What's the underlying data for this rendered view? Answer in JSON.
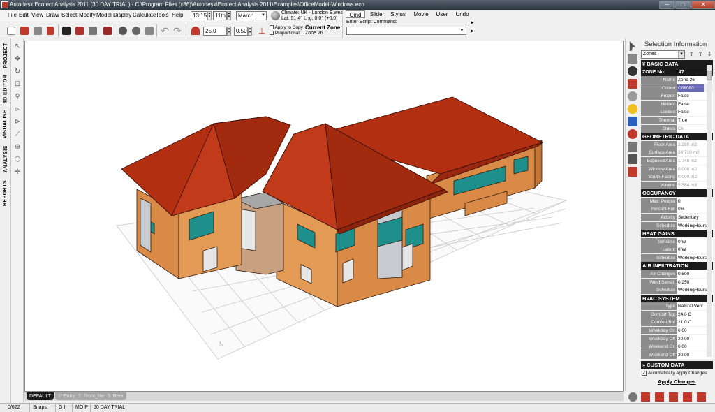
{
  "window": {
    "title": "Autodesk Ecotect Analysis 2011 (30 DAY TRIAL) - C:\\Program Files (x86)\\Autodesk\\Ecotect Analysis 2011\\Examples\\OfficeModel-Windows.eco",
    "minimize": "─",
    "maximize": "□",
    "close": "✕"
  },
  "menu": [
    "File",
    "Edit",
    "View",
    "Draw",
    "Select",
    "Modify",
    "Model",
    "Display",
    "Calculate",
    "Tools",
    "Help"
  ],
  "date": {
    "time": "13:15",
    "day": "11th",
    "month": "March",
    "climate_line1": "Climate: UK - London E.wea",
    "climate_line2": "Lat: 51.4°    Lng: 0.0° (+0.0)"
  },
  "toolbar": {
    "value1": "25.0",
    "value2": "0.50",
    "apply_copy": "Apply to Copy",
    "proportional": "Proportional",
    "current_zone_label": "Current Zone:",
    "current_zone_value": "Zone 26"
  },
  "command_panel": {
    "tabs": [
      "Cmd",
      "Slider",
      "Stylus",
      "Movie",
      "User",
      "Undo"
    ],
    "active_tab": "Cmd",
    "script_label": "Enter Script Command:",
    "script_value": ""
  },
  "left_tabs": [
    "PROJECT",
    "3D EDITOR",
    "VISUALISE",
    "ANALYSIS",
    "REPORTS"
  ],
  "view_tabs": [
    "DEFAULT",
    "1. Entry",
    "2. Front_bw",
    "3. Rear"
  ],
  "view_tab_active": "DEFAULT",
  "status": {
    "count": "0/622",
    "snaps_label": "Snaps:",
    "snaps_value": "G I",
    "mode": "MO P",
    "trial": "30 DAY TRIAL"
  },
  "selection_panel": {
    "title": "Selection Information",
    "type": "Zones",
    "sections": {
      "basic": "BASIC DATA",
      "geometric": "GEOMETRIC DATA",
      "occupancy": "OCCUPANCY",
      "heat_gains": "HEAT GAINS",
      "air_infiltration": "AIR INFILTRATION",
      "hvac": "HVAC SYSTEM",
      "custom": "CUSTOM DATA"
    },
    "zone_no_label": "ZONE No.",
    "zone_no_value": "47",
    "basic_rows": [
      {
        "label": "Name",
        "value": "Zone 26"
      },
      {
        "label": "Colour",
        "value": "C08080"
      },
      {
        "label": "Frozen",
        "value": "False"
      },
      {
        "label": "Hidden",
        "value": "False"
      },
      {
        "label": "Locked",
        "value": "False"
      },
      {
        "label": "Thermal",
        "value": "True"
      },
      {
        "label": "Status",
        "value": "Ok"
      }
    ],
    "geometric_rows": [
      {
        "label": "Floor Area",
        "value": "2.280 m2"
      },
      {
        "label": "Surface Area",
        "value": "24.710 m2"
      },
      {
        "label": "Exposed Area",
        "value": "1.746 m2"
      },
      {
        "label": "Window Area",
        "value": "0.000 m2"
      },
      {
        "label": "South Facing",
        "value": "0.000 m2"
      },
      {
        "label": "Volume",
        "value": "5.564 m3"
      }
    ],
    "occupancy_rows": [
      {
        "label": "Max. People",
        "value": "0"
      },
      {
        "label": "Percent Full",
        "value": "0%"
      },
      {
        "label": "Activity",
        "value": "Sedentary"
      },
      {
        "label": "Schedule",
        "value": "WorkingHours"
      }
    ],
    "heat_rows": [
      {
        "label": "Sensible",
        "value": "0 W"
      },
      {
        "label": "Latent",
        "value": "0 W"
      },
      {
        "label": "Schedule",
        "value": "WorkingHours"
      }
    ],
    "air_rows": [
      {
        "label": "Air Changes",
        "value": "0.500"
      },
      {
        "label": "Wind Sensit.",
        "value": "0.250"
      },
      {
        "label": "Schedule",
        "value": "WorkingHours"
      }
    ],
    "hvac_rows": [
      {
        "label": "Type",
        "value": "Natural Vent."
      },
      {
        "label": "Comfort Top",
        "value": "24.0 C"
      },
      {
        "label": "Comfort Bot",
        "value": "21.0 C"
      },
      {
        "label": "Weekday On",
        "value": "6:00"
      },
      {
        "label": "Weekday Off",
        "value": "20:00"
      },
      {
        "label": "Weekend On",
        "value": "6:00"
      },
      {
        "label": "Weekend Off",
        "value": "20:00"
      }
    ],
    "auto_apply": "Automatically Apply Changes",
    "apply_button": "Apply Changes"
  },
  "colors": {
    "roof": "#b22f12",
    "wall": "#d98a46",
    "glass": "#1e8f8a",
    "selected_colour": "#6a6ab8"
  }
}
